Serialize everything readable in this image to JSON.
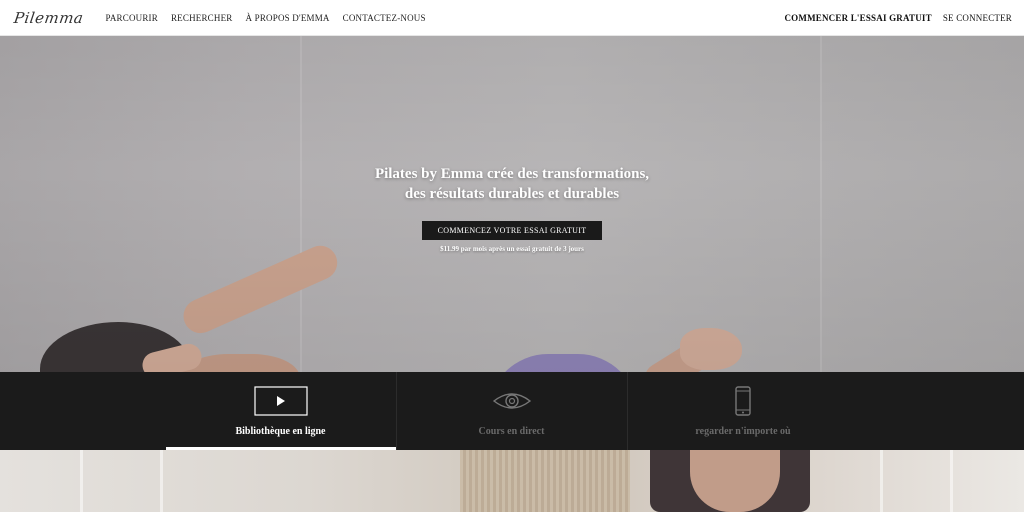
{
  "header": {
    "logo": "Pilemma",
    "nav": [
      "PARCOURIR",
      "RECHERCHER",
      "À PROPOS D'EMMA",
      "CONTACTEZ-NOUS"
    ],
    "trial_link": "COMMENCER L'ESSAI GRATUIT",
    "login_link": "SE CONNECTER"
  },
  "hero": {
    "title_line1": "Pilates by Emma crée des transformations,",
    "title_line2": "des résultats durables et durables",
    "cta_label": "COMMENCEZ VOTRE ESSAI GRATUIT",
    "price_note": "$11.99 par mois après un essai gratuit de 3 jours"
  },
  "features": [
    {
      "label": "Bibliothèque en ligne",
      "icon": "play-icon",
      "active": true
    },
    {
      "label": "Cours en direct",
      "icon": "eye-icon",
      "active": false
    },
    {
      "label": "regarder n'importe où",
      "icon": "phone-icon",
      "active": false
    }
  ],
  "colors": {
    "bar_bg": "#1b1b1b",
    "active_text": "#ffffff",
    "inactive_text": "#6a6a6a"
  }
}
